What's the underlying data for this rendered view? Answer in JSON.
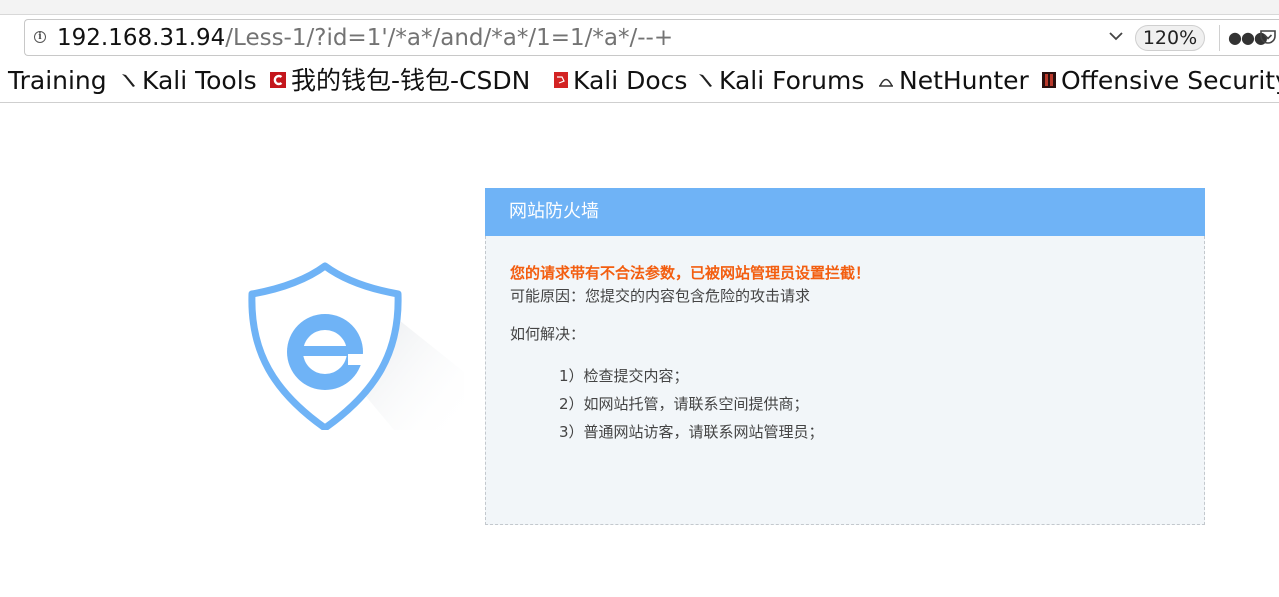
{
  "browser": {
    "url_host": "192.168.31.94",
    "url_path": "/Less-1/?id=1'/*a*/and/*a*/1=1/*a*/--+",
    "zoom": "120%",
    "icons": {
      "info": "info-icon",
      "dropdown": "chevron-down-icon",
      "more": "more-actions-icon",
      "pocket": "pocket-icon"
    }
  },
  "bookmarks": [
    {
      "label": "Training",
      "icon": "none"
    },
    {
      "label": "Kali Tools",
      "icon": "kali-dragon-icon"
    },
    {
      "label": "我的钱包-钱包-CSDN",
      "icon": "csdn-icon"
    },
    {
      "label": "Kali Docs",
      "icon": "kali-docs-icon"
    },
    {
      "label": "Kali Forums",
      "icon": "kali-dragon-icon"
    },
    {
      "label": "NetHunter",
      "icon": "nethunter-icon"
    },
    {
      "label": "Offensive Security",
      "icon": "offsec-icon"
    }
  ],
  "waf": {
    "title": "网站防火墙",
    "error": "您的请求带有不合法参数，已被网站管理员设置拦截！",
    "reason": "可能原因：您提交的内容包含危险的攻击请求",
    "how_label": "如何解决：",
    "steps": [
      "1）检查提交内容；",
      "2）如网站托管，请联系空间提供商；",
      "3）普通网站访客，请联系网站管理员；"
    ],
    "colors": {
      "header": "#6fb3f6",
      "error": "#f35e10",
      "body_bg": "#f2f6f9"
    }
  }
}
